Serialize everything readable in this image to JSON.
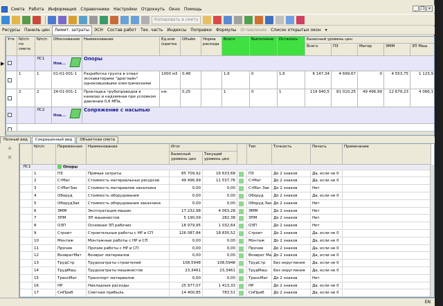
{
  "menu": [
    "Смета",
    "Работа",
    "Информация",
    "Справочники",
    "Настройки",
    "Отдохнуть",
    "Окно",
    "Помощь"
  ],
  "toolbar": {
    "copy_label": "Копировать в смету"
  },
  "tabs_top": [
    {
      "label": "Ресурсы",
      "state": "normal"
    },
    {
      "label": "Панель цен",
      "state": "normal"
    },
    {
      "label": "Лимит. затраты",
      "state": "active"
    },
    {
      "label": "ЭСН",
      "state": "normal"
    },
    {
      "label": "Состав работ",
      "state": "normal"
    },
    {
      "label": "Тех. часть",
      "state": "normal"
    },
    {
      "label": "Индексы",
      "state": "normal"
    },
    {
      "label": "Поправки",
      "state": "normal"
    },
    {
      "label": "Формулы",
      "state": "normal"
    },
    {
      "label": "Оглавление",
      "state": "disabled"
    },
    {
      "label": "Список открытых окон",
      "state": "normal"
    }
  ],
  "upper": {
    "headers": {
      "ute": "Уте",
      "num": "N/п/п по смете",
      "npp": "N/п/п",
      "just": "Обоснование",
      "name": "Наименование",
      "unit": "Ед.изм (кратка",
      "vol": "Объём",
      "norm": "Норма расхода",
      "all": "Всего",
      "done": "Выполнено",
      "left": "Осталось",
      "base": "Базисный уровень цен",
      "b_all": "Всего",
      "b_pz": "ПЗ",
      "b_mat": "Матер",
      "b_emm": "ЭММ",
      "b_zpm": "ЗП Маш"
    },
    "groups": [
      {
        "code": "ЛС1",
        "status": "Нов...",
        "title": "Опоры"
      },
      {
        "code": "ЛС2",
        "status": "Нов...",
        "title": "Сопряжение с насыпью"
      }
    ],
    "rows": [
      {
        "num": "1",
        "npp": "1",
        "just": "01-01-001-1",
        "name": "Разработка грунта в отвал экскаваторами \"драглайн\" одноковшовыми электрическими",
        "unit": "1000 м3",
        "vol": "0,48",
        "all": "1,6",
        "done": "0",
        "left": "1,6",
        "b_all": "6 147,34",
        "b_pz": "4 699,67",
        "b_mat": "0",
        "b_emm": "4 553,75",
        "b_zpm": "1 123,9"
      },
      {
        "num": "2",
        "npp": "2",
        "just": "24-01-001-1",
        "name": "Прокладка трубопроводов в каналах и надземная при условном давлении 0,6 МПа,",
        "unit": "км.",
        "vol": "0,25",
        "all": "1",
        "done": "0",
        "left": "1",
        "b_all": "119 940,5",
        "b_pz": "81 010,25",
        "b_mat": "49 496,99",
        "b_emm": "12 679,23",
        "b_zpm": "4 066,1"
      }
    ]
  },
  "view_tabs": [
    "Полный вид",
    "Сокращенный вид",
    "Объектная смета"
  ],
  "lower": {
    "headers": {
      "num": "N/п/п",
      "var": "Переменная",
      "name": "Наименование",
      "total": "Итог",
      "base": "Базисный уровень цен",
      "cur": "Текущий уровень цен",
      "type": "Тип",
      "prec": "Точность",
      "print": "Печать",
      "note": "Примечание"
    },
    "group": {
      "code": "ЛС1",
      "title": "Опоры"
    },
    "rows": [
      {
        "n": "1",
        "var": "ПЗ",
        "name": "Прямые затраты",
        "base": "85 709,92",
        "cur": "16 633,68",
        "type": "ПЗ",
        "prec": "До 2 знаков",
        "print": "Да, если не 0"
      },
      {
        "n": "2",
        "var": "СтМат",
        "name": "Стоимость материальных ресурсов",
        "base": "49 496,99",
        "cur": "11 537,76",
        "type": "СтМат",
        "prec": "До 2 знаков",
        "print": "Да, если не 0"
      },
      {
        "n": "3",
        "var": "СтМатЗак",
        "name": "Стоимость материалов заказчика",
        "base": "0,00",
        "cur": "0,00",
        "type": "СтМат.Зак",
        "prec": "До 2 знаков",
        "print": "Нет"
      },
      {
        "n": "4",
        "var": "Оборуд",
        "name": "Стоимость оборудования",
        "base": "0,00",
        "cur": "0,00",
        "type": "Оборуд",
        "prec": "До 2 знаков",
        "print": "Да, если не 0"
      },
      {
        "n": "5",
        "var": "ОборудЗак",
        "name": "Стоимость оборудования заказчика",
        "base": "0,00",
        "cur": "0,00",
        "type": "Оборуд.Зак",
        "prec": "До 2 знаков",
        "print": "Нет"
      },
      {
        "n": "6",
        "var": "ЭММ",
        "name": "Эксплуатация машин",
        "base": "17 232,98",
        "cur": "4 063,28",
        "type": "ЭММ",
        "prec": "До 2 знаков",
        "print": "Нет"
      },
      {
        "n": "7",
        "var": "ЗПМ",
        "name": "ЗП машинистов",
        "base": "5 190,09",
        "cur": "282,38",
        "type": "ЗПМ",
        "prec": "До 2 знаков",
        "print": "Нет"
      },
      {
        "n": "8",
        "var": "ОЗП",
        "name": "Основная ЗП рабочих",
        "base": "18 979,95",
        "cur": "1 032,64",
        "type": "ОЗП",
        "prec": "До 2 знаков",
        "print": "Нет"
      },
      {
        "n": "9",
        "var": "Строит",
        "name": "Строительные работы с НР и СП",
        "base": "126 087,84",
        "cur": "18 830,52",
        "type": "Строит",
        "prec": "До 2 знаков",
        "print": "Да, если не 0"
      },
      {
        "n": "10",
        "var": "Монтаж",
        "name": "Монтажные работы с НР и СП",
        "base": "0,00",
        "cur": "0,00",
        "type": "Монтаж",
        "prec": "До 2 знаков",
        "print": "Да, если не 0"
      },
      {
        "n": "11",
        "var": "Прочие",
        "name": "Прочие работы с НР и СП",
        "base": "0,00",
        "cur": "0,00",
        "type": "Прочие",
        "prec": "До 2 знаков",
        "print": "Да, если не 0"
      },
      {
        "n": "12",
        "var": "ВозвратМат",
        "name": "Возврат материалов",
        "base": "0,00",
        "cur": "0,00",
        "type": "Возврат Мат",
        "prec": "До 2 знаков",
        "print": "Да, если не 0"
      },
      {
        "n": "13",
        "var": "ТрудСтр",
        "name": "Трудозатраты строителей",
        "base": "108,5948",
        "cur": "108,5948",
        "type": "ТрудСтр",
        "prec": "Без округления",
        "print": "Да, если не 0"
      },
      {
        "n": "14",
        "var": "ТрудМаш",
        "name": "Трудозатраты машинистов",
        "base": "23,3461",
        "cur": "23,3461",
        "type": "ТрудМаш",
        "prec": "Без округления",
        "print": "Да, если не 0"
      },
      {
        "n": "15",
        "var": "ТрансМат",
        "name": "Транспорт материалов",
        "base": "0,00",
        "cur": "0,00",
        "type": "ТрансМат",
        "prec": "До 2 знаков",
        "print": "Нет"
      },
      {
        "n": "16",
        "var": "НР",
        "name": "Накладные расходы",
        "base": "25 977,07",
        "cur": "1 413,33",
        "type": "НР",
        "prec": "До 2 знаков",
        "print": "Да, если не 0"
      },
      {
        "n": "17",
        "var": "СмПриб",
        "name": "Сметная прибыль",
        "base": "14 400,85",
        "cur": "783,51",
        "type": "СмПриб",
        "prec": "До 2 знаков",
        "print": "Да, если не 0"
      }
    ]
  },
  "status": {
    "lang": "EN"
  },
  "colors": {
    "green": "#3fe03f",
    "group_title": "#1a1a8c",
    "group_bg": "#e6e6f8"
  }
}
